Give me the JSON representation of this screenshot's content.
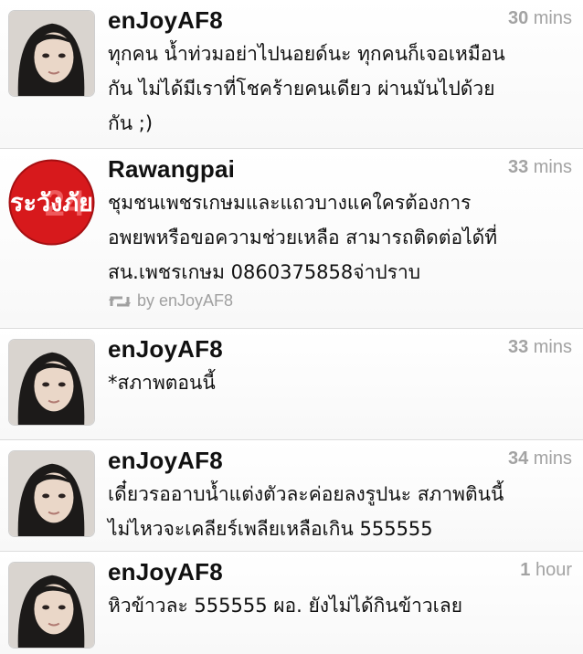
{
  "tweets": [
    {
      "name": "enJoyAF8",
      "time_value": "30",
      "time_unit": "mins",
      "avatar": "person-photo-avatar",
      "text_lines": [
        "ทุกคน น้ำท่วมอย่าไปนอยด์นะ ทุกคนก็เจอเหมือน",
        "กัน ไม่ได้มีเราที่โชคร้ายคนเดียว ผ่านมันไปด้วย",
        "กัน ;)"
      ]
    },
    {
      "name": "Rawangpai",
      "time_value": "33",
      "time_unit": "mins",
      "avatar": "rawangpai-logo-avatar",
      "avatar_label": "ระวังภัย",
      "avatar_badge": "24",
      "text_lines": [
        "ชุมชนเพชรเกษมและแถวบางแคใครต้องการ",
        "อพยพหรือขอความช่วยเหลือ สามารถติดต่อได้ที่",
        "สน.เพชรเกษม 0860375858จ่าปราบ"
      ],
      "retweet_icon": "retweet-icon",
      "retweeted_by": "by enJoyAF8"
    },
    {
      "name": "enJoyAF8",
      "time_value": "33",
      "time_unit": "mins",
      "avatar": "person-photo-avatar",
      "text_lines": [
        "*สภาพตอนนี้"
      ]
    },
    {
      "name": "enJoyAF8",
      "time_value": "34",
      "time_unit": "mins",
      "avatar": "person-photo-avatar",
      "text_lines": [
        "เดี๋ยวรออาบน้ำแต่งตัวละค่อยลงรูปนะ สภาพตินนี้",
        "ไม่ไหวจะเคลียร์เพลียเหลือเกิน 555555"
      ]
    },
    {
      "name": "enJoyAF8",
      "time_value": "1",
      "time_unit": "hour",
      "avatar": "person-photo-avatar",
      "text_lines": [
        "หิวข้าวละ 555555 ผอ. ยังไม่ได้กินข้าวเลย"
      ]
    }
  ],
  "colors": {
    "name": "#111111",
    "timestamp": "#a3a3a3",
    "divider": "#dcdcdc",
    "logo_red": "#d7191c"
  }
}
